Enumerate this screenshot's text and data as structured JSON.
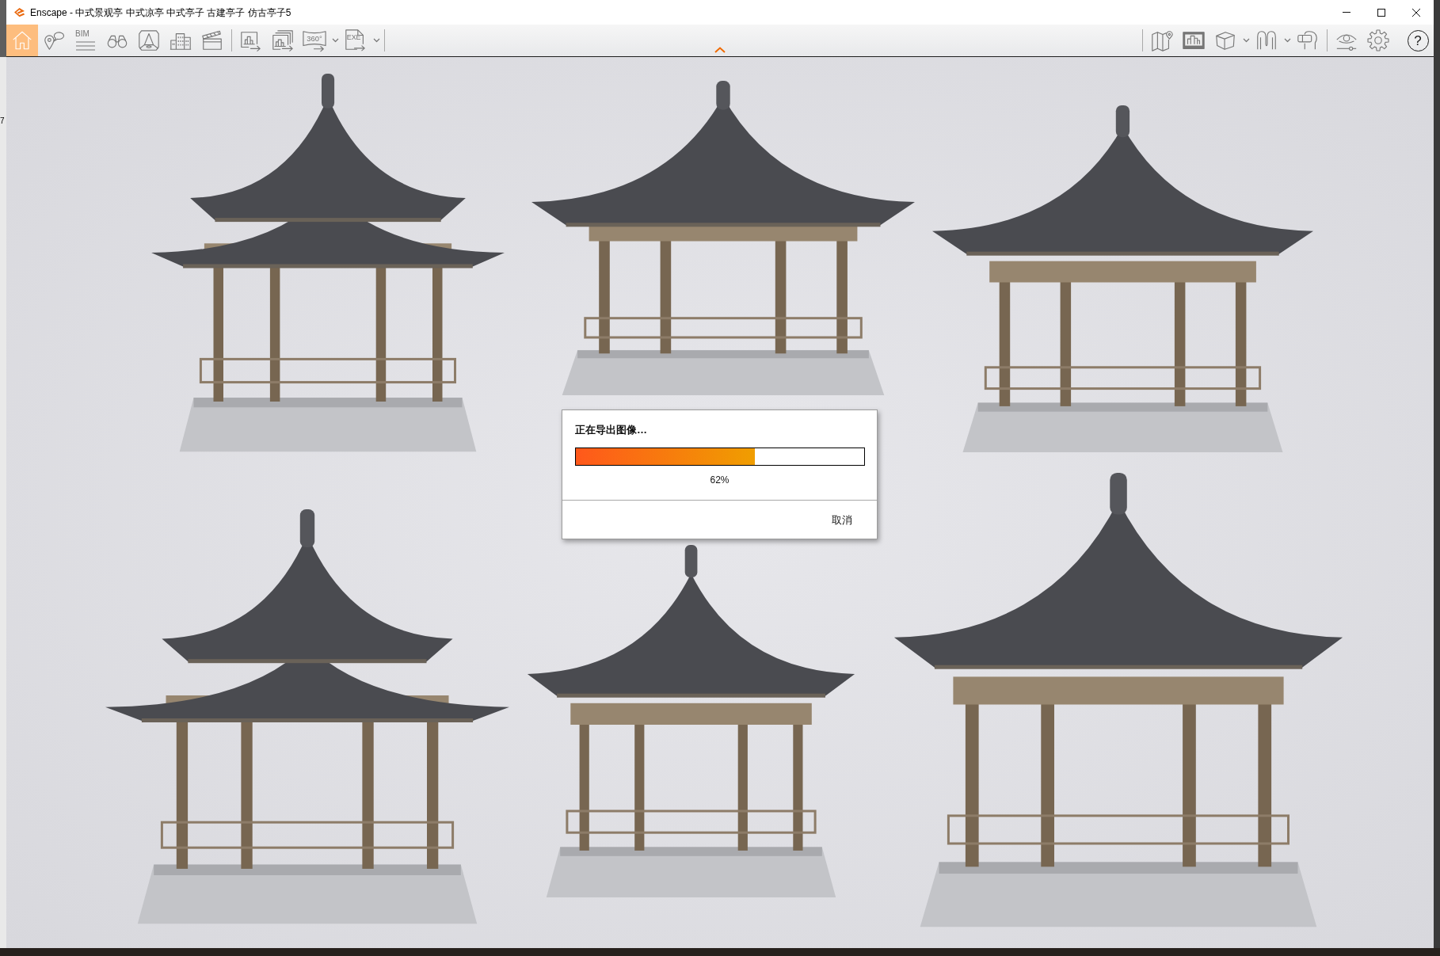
{
  "window": {
    "title": "Enscape - 中式景观亭 中式凉亭 中式亭子 古建亭子 仿古亭子5"
  },
  "toolbar": {
    "left_groups": [
      [
        {
          "kind": "home",
          "selected": true,
          "has_menu": false
        },
        {
          "kind": "pin",
          "selected": false,
          "has_menu": false
        },
        {
          "kind": "bim",
          "label": "BIM",
          "selected": false,
          "has_menu": false
        },
        {
          "kind": "binoculars",
          "selected": false,
          "has_menu": false
        },
        {
          "kind": "frame",
          "selected": false,
          "has_menu": false
        },
        {
          "kind": "buildings",
          "selected": false,
          "has_menu": false
        },
        {
          "kind": "clapper",
          "selected": false,
          "has_menu": false
        }
      ],
      [
        {
          "kind": "screenshot",
          "selected": false,
          "has_menu": false
        },
        {
          "kind": "batch",
          "selected": false,
          "has_menu": false
        },
        {
          "kind": "panorama",
          "label": "360°",
          "selected": false,
          "has_menu": true
        },
        {
          "kind": "exe",
          "label": "EXE",
          "selected": false,
          "has_menu": true
        }
      ]
    ],
    "right_groups": [
      [
        {
          "kind": "map",
          "selected": false,
          "has_menu": false
        },
        {
          "kind": "gallery",
          "selected": false,
          "has_menu": false
        },
        {
          "kind": "cube",
          "selected": false,
          "has_menu": true
        },
        {
          "kind": "asset",
          "selected": false,
          "has_menu": true
        },
        {
          "kind": "vr",
          "selected": false,
          "has_menu": false
        }
      ],
      [
        {
          "kind": "eye",
          "selected": false,
          "has_menu": false
        },
        {
          "kind": "gear",
          "selected": false,
          "has_menu": false
        },
        {
          "kind": "help",
          "label": "?",
          "selected": false
        }
      ]
    ]
  },
  "dialog": {
    "title": "正在导出图像…",
    "progress": {
      "level": 0.62,
      "reading": "62%"
    },
    "buttons": [
      "取消"
    ]
  },
  "desktop": {
    "edge_text": "7"
  }
}
